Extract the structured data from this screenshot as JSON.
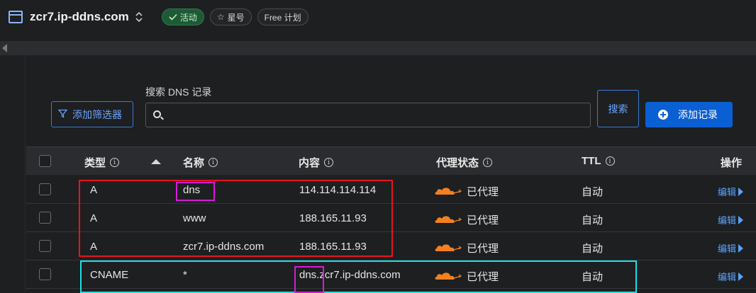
{
  "header": {
    "site_name": "zcr7.ip-ddns.com",
    "status_label": "活动",
    "star_label": "星号",
    "plan_label": "Free 计划"
  },
  "toolbar": {
    "filter_label": "添加筛选器",
    "search_label": "搜索 DNS 记录",
    "search_value": "",
    "search_button": "搜索",
    "add_record_label": "添加记录"
  },
  "table": {
    "columns": {
      "type": "类型",
      "name": "名称",
      "content": "内容",
      "proxy_status": "代理状态",
      "ttl": "TTL",
      "actions": "操作"
    },
    "rows": [
      {
        "type": "A",
        "name": "dns",
        "content": "114.114.114.114",
        "proxy": "已代理",
        "ttl": "自动",
        "action": "编辑"
      },
      {
        "type": "A",
        "name": "www",
        "content": "188.165.11.93",
        "proxy": "已代理",
        "ttl": "自动",
        "action": "编辑"
      },
      {
        "type": "A",
        "name": "zcr7.ip-ddns.com",
        "content": "188.165.11.93",
        "proxy": "已代理",
        "ttl": "自动",
        "action": "编辑"
      },
      {
        "type": "CNAME",
        "name": "*",
        "content": "dns.zcr7.ip-ddns.com",
        "proxy": "已代理",
        "ttl": "自动",
        "action": "编辑"
      }
    ]
  },
  "colors": {
    "accent": "#0a5fd3",
    "link": "#5aa2ff",
    "cloud": "#f38020",
    "status_active": "#1f5a36"
  },
  "icons": {
    "site": "window-icon",
    "switch": "chevron-updown-icon",
    "check": "check-icon",
    "star": "star-icon",
    "filter": "filter-icon",
    "search": "search-icon",
    "add": "plus-circle-icon",
    "info": "info-icon",
    "sort": "sort-up-icon",
    "proxy": "cloud-icon",
    "edit": "caret-right-icon"
  }
}
